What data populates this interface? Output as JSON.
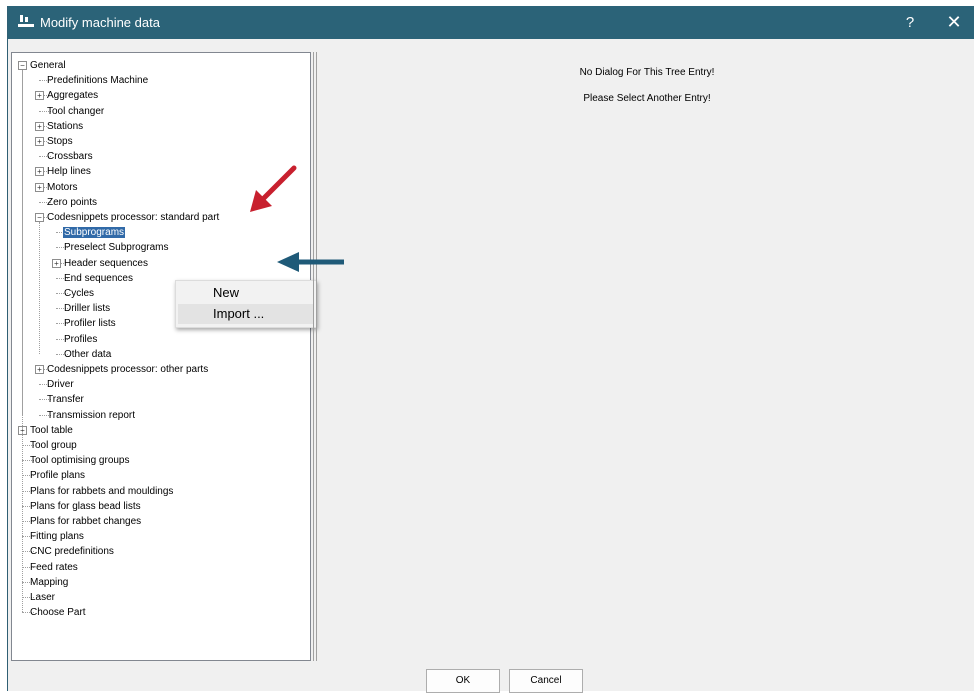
{
  "window": {
    "title": "Modify machine data",
    "help_label": "?",
    "close_label": "✕"
  },
  "tree": [
    {
      "label": "General",
      "level": 0,
      "expander": "minus"
    },
    {
      "label": "Predefinitions Machine",
      "level": 1,
      "expander": null
    },
    {
      "label": "Aggregates",
      "level": 1,
      "expander": "plus"
    },
    {
      "label": "Tool changer",
      "level": 1,
      "expander": null
    },
    {
      "label": "Stations",
      "level": 1,
      "expander": "plus"
    },
    {
      "label": "Stops",
      "level": 1,
      "expander": "plus"
    },
    {
      "label": "Crossbars",
      "level": 1,
      "expander": null
    },
    {
      "label": "Help lines",
      "level": 1,
      "expander": "plus"
    },
    {
      "label": "Motors",
      "level": 1,
      "expander": "plus"
    },
    {
      "label": "Zero points",
      "level": 1,
      "expander": null
    },
    {
      "label": "Codesnippets processor: standard part",
      "level": 1,
      "expander": "minus"
    },
    {
      "label": "Subprograms",
      "level": 2,
      "expander": null,
      "selected": true
    },
    {
      "label": "Preselect Subprograms",
      "level": 2,
      "expander": null
    },
    {
      "label": "Header sequences",
      "level": 2,
      "expander": "plus"
    },
    {
      "label": "End sequences",
      "level": 2,
      "expander": null
    },
    {
      "label": "Cycles",
      "level": 2,
      "expander": null
    },
    {
      "label": "Driller lists",
      "level": 2,
      "expander": null
    },
    {
      "label": "Profiler lists",
      "level": 2,
      "expander": null
    },
    {
      "label": "Profiles",
      "level": 2,
      "expander": null
    },
    {
      "label": "Other data",
      "level": 2,
      "expander": null
    },
    {
      "label": "Codesnippets processor: other parts",
      "level": 1,
      "expander": "plus"
    },
    {
      "label": "Driver",
      "level": 1,
      "expander": null
    },
    {
      "label": "Transfer",
      "level": 1,
      "expander": null
    },
    {
      "label": "Transmission report",
      "level": 1,
      "expander": null
    },
    {
      "label": "Tool table",
      "level": 0,
      "expander": "plus"
    },
    {
      "label": "Tool group",
      "level": 0,
      "expander": null
    },
    {
      "label": "Tool optimising groups",
      "level": 0,
      "expander": null
    },
    {
      "label": "Profile plans",
      "level": 0,
      "expander": null
    },
    {
      "label": "Plans for rabbets and mouldings",
      "level": 0,
      "expander": null
    },
    {
      "label": "Plans for glass bead lists",
      "level": 0,
      "expander": null
    },
    {
      "label": "Plans for rabbet changes",
      "level": 0,
      "expander": null
    },
    {
      "label": "Fitting plans",
      "level": 0,
      "expander": null
    },
    {
      "label": "CNC predefinitions",
      "level": 0,
      "expander": null
    },
    {
      "label": "Feed rates",
      "level": 0,
      "expander": null
    },
    {
      "label": "Mapping",
      "level": 0,
      "expander": null
    },
    {
      "label": "Laser",
      "level": 0,
      "expander": null
    },
    {
      "label": "Choose Part",
      "level": 0,
      "expander": null
    }
  ],
  "context_menu": {
    "new_label": "New",
    "import_label": "Import ..."
  },
  "right_panel": {
    "message_1": "No Dialog For This Tree Entry!",
    "message_2": "Please Select Another Entry!"
  },
  "buttons": {
    "ok_label": "OK",
    "cancel_label": "Cancel"
  },
  "colors": {
    "titlebar": "#2b6378",
    "selection": "#316aa8",
    "arrow_red": "#c8202e",
    "arrow_blue": "#1f5a78"
  }
}
